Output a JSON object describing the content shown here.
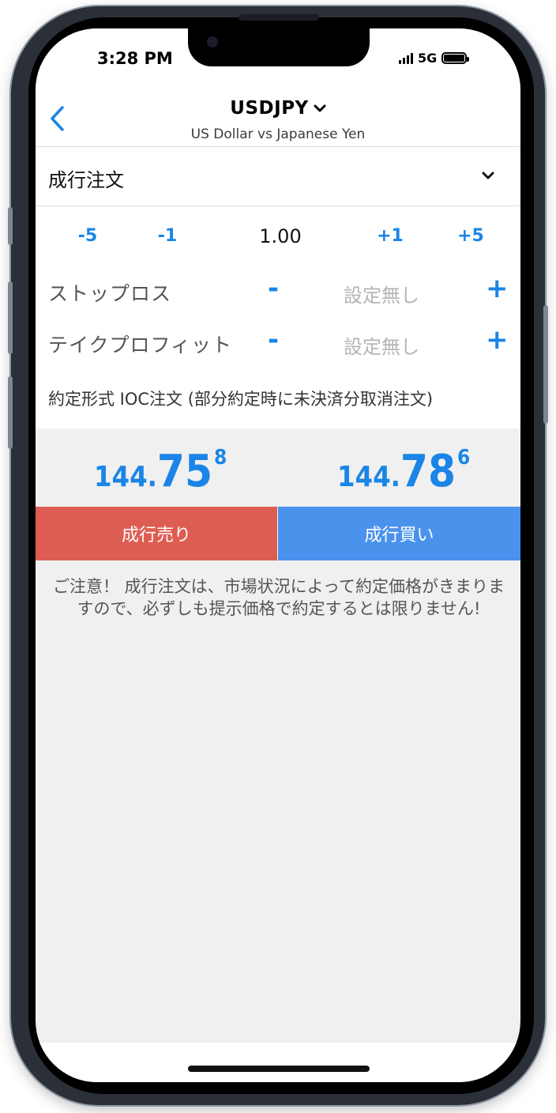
{
  "status": {
    "time": "3:28 PM",
    "network": "5G"
  },
  "header": {
    "symbol": "USDJPY",
    "subtitle": "US Dollar vs Japanese Yen"
  },
  "order": {
    "type_label": "成行注文"
  },
  "quantity": {
    "minus5": "-5",
    "minus1": "-1",
    "value": "1.00",
    "plus1": "+1",
    "plus5": "+5"
  },
  "stop_loss": {
    "label": "ストップロス",
    "minus": "-",
    "value": "設定無し",
    "plus": "+"
  },
  "take_profit": {
    "label": "テイクプロフィット",
    "minus": "-",
    "value": "設定無し",
    "plus": "+"
  },
  "execution": {
    "text": "約定形式 IOC注文 (部分約定時に未決済分取消注文)"
  },
  "prices": {
    "sell": {
      "small": "144.",
      "big": "75",
      "sup": "8"
    },
    "buy": {
      "small": "144.",
      "big": "78",
      "sup": "6"
    }
  },
  "buttons": {
    "sell": "成行売り",
    "buy": "成行買い"
  },
  "notice": "ご注意！ 成行注文は、市場状況によって約定価格がきまりますので、必ずしも提示価格で約定するとは限りません!",
  "colors": {
    "accent": "#1a85e6",
    "sell": "#de5d52",
    "buy": "#4b92ec"
  },
  "icons": {
    "back": "chevron-left-icon",
    "dropdown": "chevron-down-icon"
  }
}
